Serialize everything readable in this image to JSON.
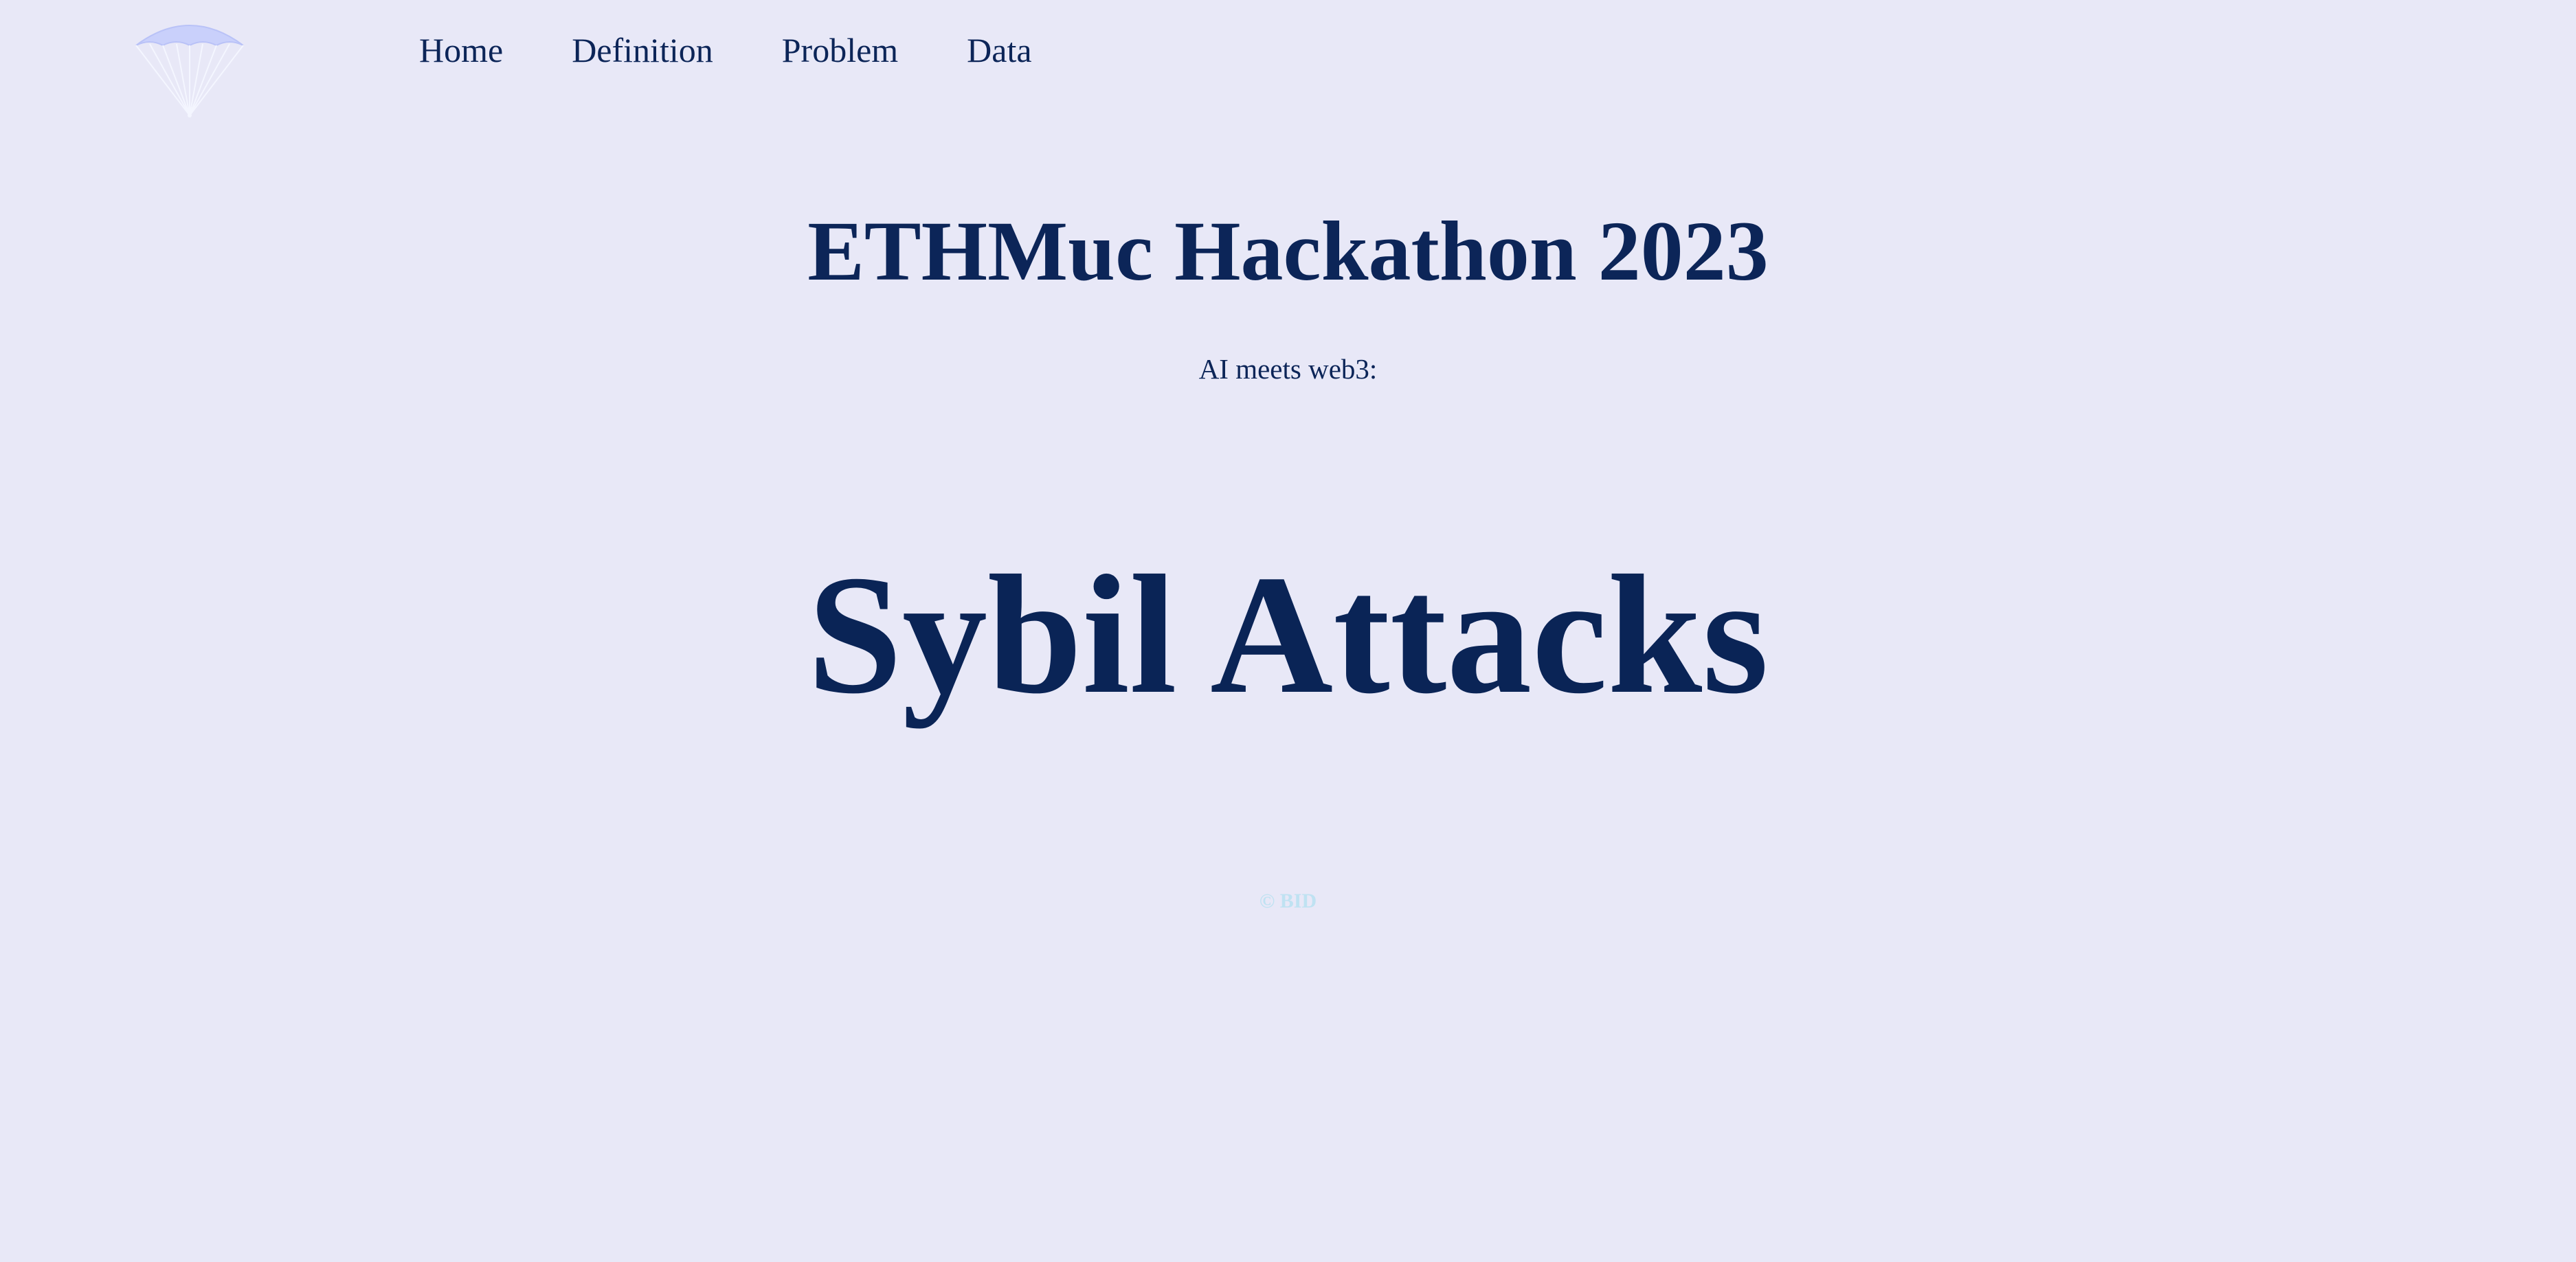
{
  "header": {
    "logo_icon": "parachute-icon",
    "nav": [
      {
        "label": "Home"
      },
      {
        "label": "Definition"
      },
      {
        "label": "Problem"
      },
      {
        "label": "Data"
      }
    ]
  },
  "main": {
    "title": "ETHMuc Hackathon 2023",
    "subtitle": "AI meets web3:",
    "headline": "Sybil Attacks"
  },
  "footer": {
    "text": "© BID"
  },
  "colors": {
    "background": "#e8e8f7",
    "text": "#0c2558",
    "footer_text": "#bfe2f2",
    "logo": "#c9d0fb"
  }
}
